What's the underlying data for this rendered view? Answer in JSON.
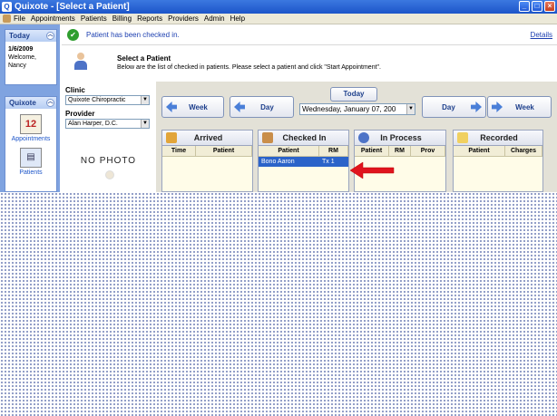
{
  "window": {
    "title": "Quixote - [Select a Patient]"
  },
  "menu": [
    "File",
    "Appointments",
    "Patients",
    "Billing",
    "Reports",
    "Providers",
    "Admin",
    "Help"
  ],
  "sidebar": {
    "today": {
      "header": "Today",
      "date": "1/6/2009",
      "welcome": "Welcome,",
      "user": "Nancy"
    },
    "quixote": {
      "header": "Quixote",
      "items": [
        {
          "label": "Appointments",
          "icon": "calendar-icon",
          "icon_text": "12"
        },
        {
          "label": "Patients",
          "icon": "patients-icon",
          "icon_text": ""
        }
      ]
    }
  },
  "banner": {
    "message": "Patient has been checked in.",
    "details": "Details"
  },
  "select": {
    "title": "Select a Patient",
    "subtitle": "Below are the list of checked in patients. Please select a patient and click \"Start Appointment\"."
  },
  "clinic": {
    "label": "Clinic",
    "value": "Quixote Chiropractic"
  },
  "provider": {
    "label": "Provider",
    "value": "Alan Harper, D.C."
  },
  "photo": {
    "text": "NO PHOTO"
  },
  "nav": {
    "week_back": "Week",
    "day_back": "Day",
    "today": "Today",
    "date": "Wednesday,   January   07, 200",
    "day_fwd": "Day",
    "week_fwd": "Week"
  },
  "columns": {
    "arrived": {
      "title": "Arrived",
      "headers": [
        "Time",
        "Patient"
      ]
    },
    "checked_in": {
      "title": "Checked In",
      "headers": [
        "Patient",
        "RM"
      ],
      "rows": [
        {
          "patient": "Bono Aaron",
          "rm": "Tx 1"
        }
      ]
    },
    "in_process": {
      "title": "In Process",
      "headers": [
        "Patient",
        "RM",
        "Prov"
      ]
    },
    "recorded": {
      "title": "Recorded",
      "headers": [
        "Patient",
        "Charges"
      ]
    }
  },
  "colors": {
    "accent": "#1c55c9",
    "selection": "#2b63c9",
    "annotation": "#e0141e",
    "success": "#2f9e2f"
  }
}
